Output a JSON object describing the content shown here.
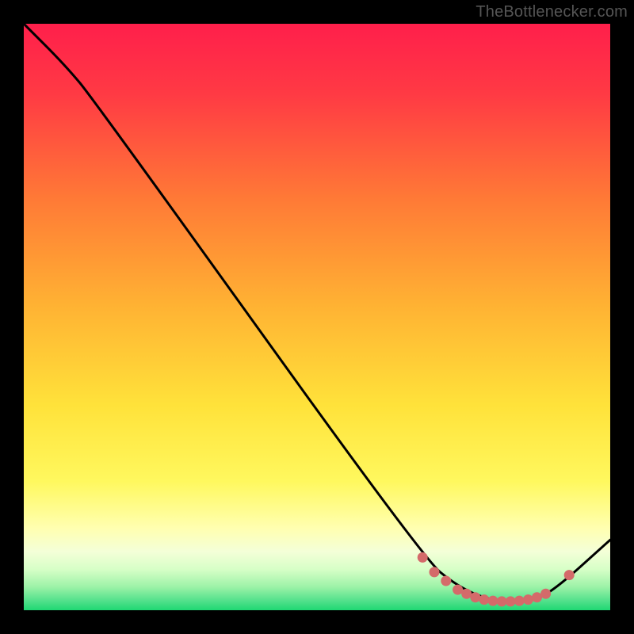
{
  "attribution": "TheBottlenecker.com",
  "chart_data": {
    "type": "line",
    "title": "",
    "xlabel": "",
    "ylabel": "",
    "xlim": [
      0,
      100
    ],
    "ylim": [
      0,
      100
    ],
    "curve": [
      {
        "x": 0,
        "y": 100
      },
      {
        "x": 7,
        "y": 93
      },
      {
        "x": 12,
        "y": 87
      },
      {
        "x": 68,
        "y": 9
      },
      {
        "x": 74,
        "y": 4
      },
      {
        "x": 80,
        "y": 1.5
      },
      {
        "x": 86,
        "y": 1.5
      },
      {
        "x": 90,
        "y": 3
      },
      {
        "x": 100,
        "y": 12
      }
    ],
    "highlight_points": [
      {
        "x": 68,
        "y": 9
      },
      {
        "x": 70,
        "y": 6.5
      },
      {
        "x": 72,
        "y": 5
      },
      {
        "x": 74,
        "y": 3.5
      },
      {
        "x": 75.5,
        "y": 2.8
      },
      {
        "x": 77,
        "y": 2.2
      },
      {
        "x": 78.5,
        "y": 1.8
      },
      {
        "x": 80,
        "y": 1.6
      },
      {
        "x": 81.5,
        "y": 1.5
      },
      {
        "x": 83,
        "y": 1.5
      },
      {
        "x": 84.5,
        "y": 1.6
      },
      {
        "x": 86,
        "y": 1.8
      },
      {
        "x": 87.5,
        "y": 2.2
      },
      {
        "x": 89,
        "y": 2.8
      },
      {
        "x": 93,
        "y": 6
      }
    ],
    "colors": {
      "top": "#ff1f4b",
      "mid": "#ffe93b",
      "bottom_green": "#26e07a",
      "band_pale": "#f6ffe0",
      "curve": "#000000",
      "point": "#d46a6a"
    }
  }
}
